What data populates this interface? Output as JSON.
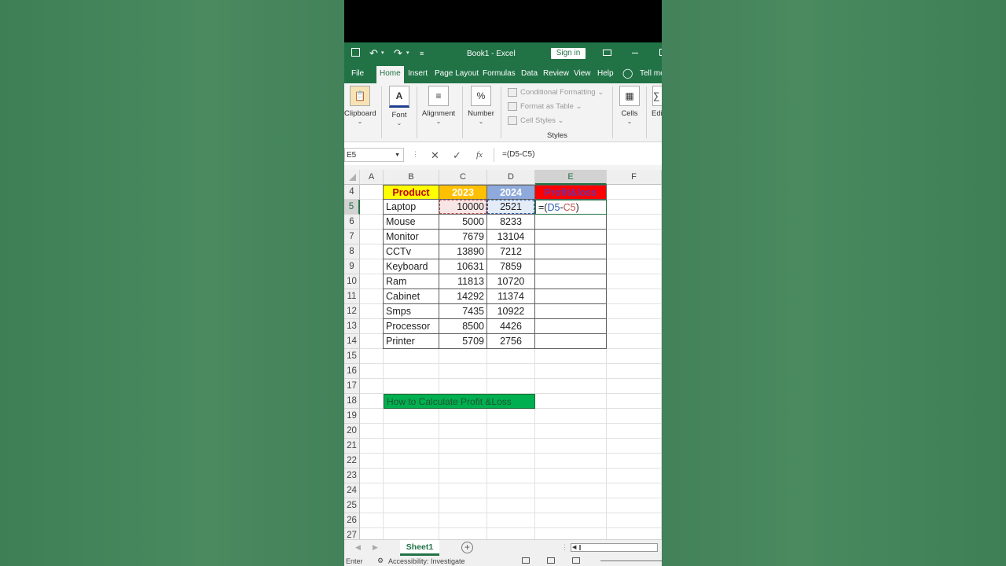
{
  "window": {
    "title": "Book1  -  Excel",
    "signin_label": "Sign in",
    "save_icon": "save-icon",
    "undo_icon": "undo-icon",
    "redo_icon": "redo-icon",
    "qat_icon": "customize-qat-icon"
  },
  "ribbon_tabs": [
    "File",
    "Home",
    "Insert",
    "Page Layout",
    "Formulas",
    "Data",
    "Review",
    "View",
    "Help"
  ],
  "tell_me": "Tell me",
  "ribbon": {
    "clipboard": "Clipboard",
    "font": "Font",
    "alignment": "Alignment",
    "number": "Number",
    "conditional_formatting": "Conditional Formatting",
    "format_as_table": "Format as Table",
    "cell_styles": "Cell Styles",
    "styles": "Styles",
    "cells": "Cells",
    "editing": "Edi",
    "font_glyph": "A",
    "number_glyph": "%"
  },
  "formula_bar": {
    "name_box": "E5",
    "formula": "=(D5-C5)",
    "fx": "fx"
  },
  "columns": [
    "A",
    "B",
    "C",
    "D",
    "E",
    "F"
  ],
  "rows": [
    "4",
    "5",
    "6",
    "7",
    "8",
    "9",
    "10",
    "11",
    "12",
    "13",
    "14",
    "15",
    "16",
    "17",
    "18",
    "19",
    "20",
    "21",
    "22",
    "23",
    "24",
    "25",
    "26",
    "27"
  ],
  "table": {
    "headers": {
      "product": "Product",
      "y2023": "2023",
      "y2024": "2024",
      "pl": "Profit&loss"
    },
    "data": [
      {
        "product": "Laptop",
        "c": "10000",
        "d": "2521"
      },
      {
        "product": "Mouse",
        "c": "5000",
        "d": "8233"
      },
      {
        "product": "Monitor",
        "c": "7679",
        "d": "13104"
      },
      {
        "product": "CCTv",
        "c": "13890",
        "d": "7212"
      },
      {
        "product": "Keyboard",
        "c": "10631",
        "d": "7859"
      },
      {
        "product": "Ram",
        "c": "11813",
        "d": "10720"
      },
      {
        "product": "Cabinet",
        "c": "14292",
        "d": "11374"
      },
      {
        "product": "Smps",
        "c": "7435",
        "d": "10922"
      },
      {
        "product": "Processor",
        "c": "8500",
        "d": "4426"
      },
      {
        "product": "Printer",
        "c": "5709",
        "d": "2756"
      }
    ],
    "editing_cell_text": "=(D5-C5)",
    "editing_parts": [
      "=(",
      "D5",
      "-",
      "C5",
      ")"
    ]
  },
  "banner": "How to Calculate Profit &Loss",
  "sheet_tab": "Sheet1",
  "status": {
    "mode": "Enter",
    "accessibility": "Accessibility: Investigate"
  },
  "colors": {
    "excel_green": "#217346",
    "product_hdr": "#ffff00",
    "y2023_hdr": "#ffc000",
    "y2024_hdr": "#8ea9db",
    "pl_hdr": "#ff0000",
    "banner": "#00b050"
  }
}
